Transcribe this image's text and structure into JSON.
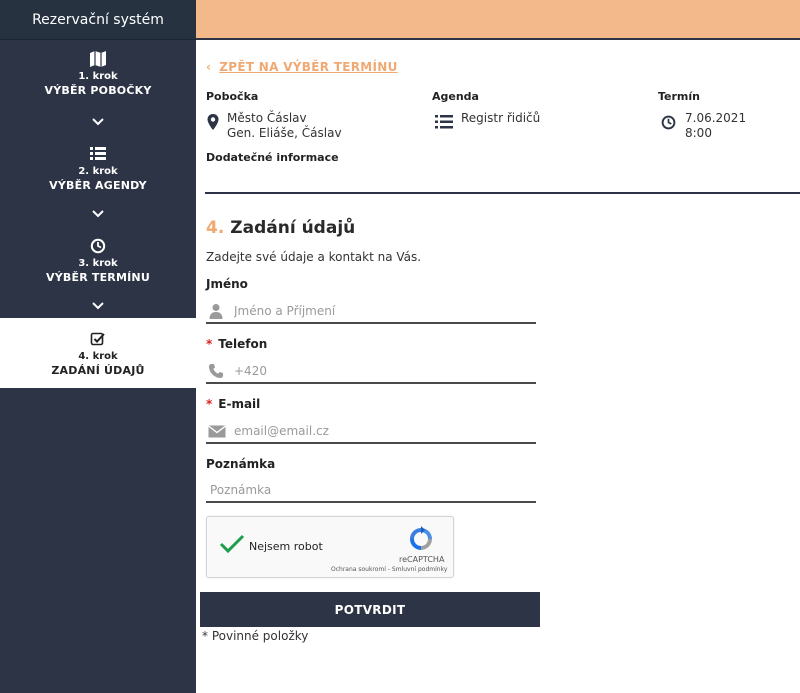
{
  "sidebar": {
    "brand": "Rezervační systém",
    "steps": [
      {
        "step": "1. krok",
        "title": "VÝBĚR POBOČKY",
        "icon": "map-icon"
      },
      {
        "step": "2. krok",
        "title": "VÝBĚR AGENDY",
        "icon": "list-icon"
      },
      {
        "step": "3. krok",
        "title": "VÝBĚR TERMÍNU",
        "icon": "clock-icon"
      },
      {
        "step": "4. krok",
        "title": "ZADÁNÍ ÚDAJŮ",
        "icon": "checkbox-icon"
      }
    ]
  },
  "summary": {
    "back_link": "ZPĚT NA VÝBĚR TERMÍNU",
    "branch_label": "Pobočka",
    "branch_line1": "Město Čáslav",
    "branch_line2": "Gen. Eliáše, Čáslav",
    "agenda_label": "Agenda",
    "agenda_value": "Registr řidičů",
    "term_label": "Termín",
    "term_date": "7.06.2021",
    "term_time": "8:00",
    "extra_label": "Dodatečné informace"
  },
  "form": {
    "step_number": "4.",
    "title": "Zadání údajů",
    "description": "Zadejte své údaje a kontakt na Vás.",
    "name_label": "Jméno",
    "name_placeholder": "Jméno a Příjmení",
    "required_mark": "*",
    "phone_label": "Telefon",
    "phone_placeholder": "+420",
    "email_label": "E-mail",
    "email_placeholder": "email@email.cz",
    "note_label": "Poznámka",
    "note_placeholder": "Poznámka",
    "submit_label": "POTVRDIT",
    "required_note": "* Povinné položky"
  },
  "captcha": {
    "label": "Nejsem robot",
    "brand": "reCAPTCHA",
    "links": "Ochrana soukromí - Smluvní podmínky"
  },
  "colors": {
    "accent": "#f0a972",
    "topbar": "#f4b98a",
    "sidebar": "#2c3445",
    "required": "#d8241f"
  }
}
